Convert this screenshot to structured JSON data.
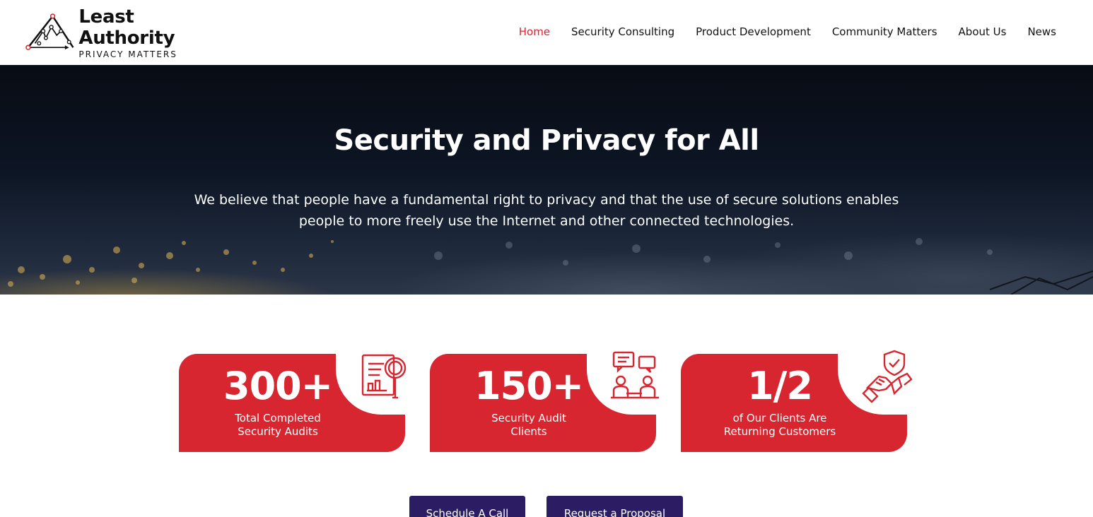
{
  "brand": {
    "title": "Least Authority",
    "tagline": "PRIVACY MATTERS",
    "logo_icon": "network-mountain-logo"
  },
  "nav": {
    "items": [
      {
        "label": "Home",
        "active": true
      },
      {
        "label": "Security Consulting",
        "active": false
      },
      {
        "label": "Product Development",
        "active": false
      },
      {
        "label": "Community Matters",
        "active": false
      },
      {
        "label": "About Us",
        "active": false
      },
      {
        "label": "News",
        "active": false
      }
    ]
  },
  "hero": {
    "title": "Security and Privacy for All",
    "text": "We believe that people have a fundamental right to privacy and that the use of secure solutions enables people to more freely use the Internet and other connected technologies."
  },
  "stats": [
    {
      "value": "300+",
      "label_line1": "Total Completed",
      "label_line2": "Security Audits",
      "icon": "audit-report-magnifier-icon"
    },
    {
      "value": "150+",
      "label_line1": "Security Audit",
      "label_line2": "Clients",
      "icon": "client-meeting-icon"
    },
    {
      "value": "1/2",
      "label_line1": "of Our Clients Are",
      "label_line2": "Returning Customers",
      "icon": "handshake-shield-icon"
    }
  ],
  "cta": {
    "schedule_label": "Schedule A Call",
    "proposal_label": "Request a Proposal"
  },
  "colors": {
    "accent_red": "#d7262f",
    "button_purple": "#2b1c63",
    "hero_dark": "#0d1524"
  }
}
